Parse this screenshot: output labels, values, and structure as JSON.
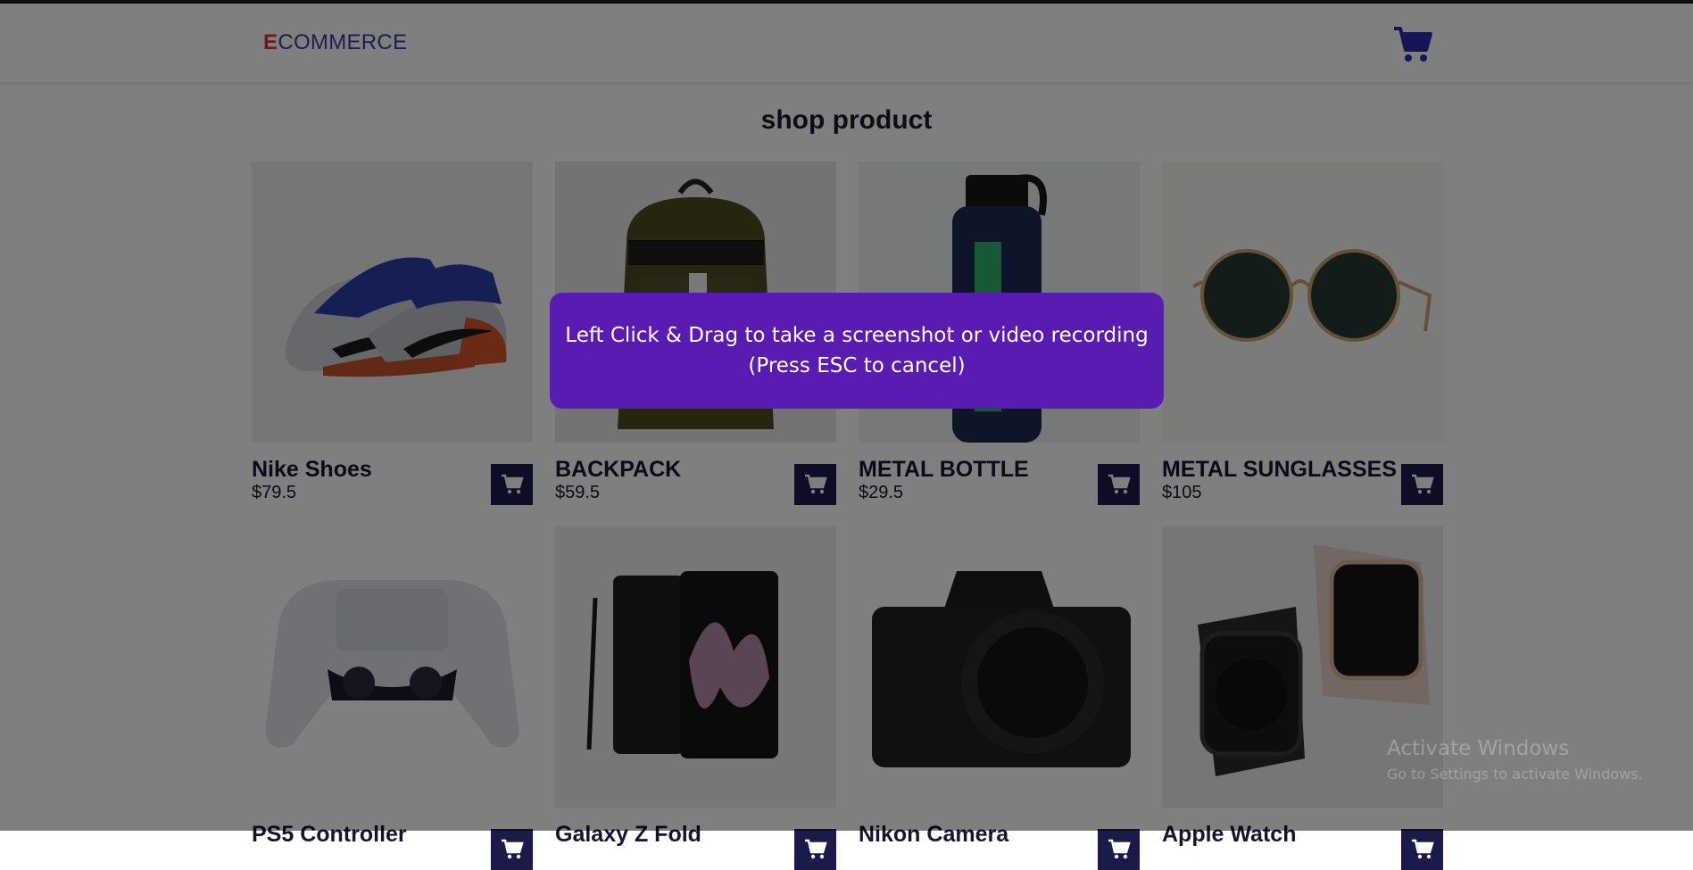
{
  "header": {
    "logo_first": "E",
    "logo_rest": "COMMERCE",
    "cart_icon": "cart-icon",
    "colors": {
      "logo_text": "#3a3aa8",
      "logo_accent": "#e0322c",
      "cart": "#2b2bb0"
    }
  },
  "page": {
    "heading": "shop product"
  },
  "products": [
    {
      "name": "Nike Shoes",
      "price": "$79.5",
      "image": "sneaker"
    },
    {
      "name": "BACKPACK",
      "price": "$59.5",
      "image": "backpack"
    },
    {
      "name": "METAL BOTTLE",
      "price": "$29.5",
      "image": "bottle"
    },
    {
      "name": "METAL SUNGLASSES",
      "price": "$105",
      "image": "sunglasses"
    },
    {
      "name": "PS5 Controller",
      "price": "",
      "image": "gamepad"
    },
    {
      "name": "Galaxy Z Fold",
      "price": "",
      "image": "foldable-phone"
    },
    {
      "name": "Nikon Camera",
      "price": "",
      "image": "camera"
    },
    {
      "name": "Apple Watch",
      "price": "",
      "image": "smartwatch"
    }
  ],
  "overlay": {
    "line1": "Left Click & Drag to take a screenshot or video recording",
    "line2": "(Press ESC to cancel)",
    "color": "#5a1bb3"
  },
  "watermark": {
    "line1": "Activate Windows",
    "line2": "Go to Settings to activate Windows."
  }
}
